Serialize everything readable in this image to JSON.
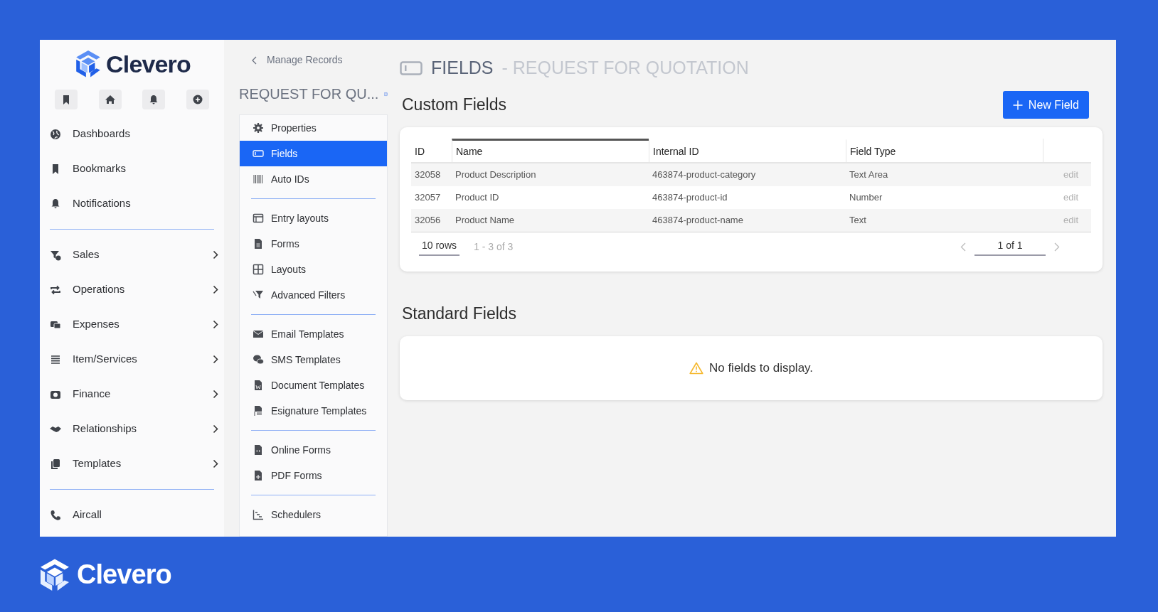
{
  "sidebar": {
    "logo": "Clevero",
    "items": [
      {
        "label": "Dashboards",
        "kind": "link"
      },
      {
        "label": "Bookmarks",
        "kind": "link"
      },
      {
        "label": "Notifications",
        "kind": "link"
      },
      {
        "label": "Sales",
        "kind": "group"
      },
      {
        "label": "Operations",
        "kind": "group"
      },
      {
        "label": "Expenses",
        "kind": "group"
      },
      {
        "label": "Item/Services",
        "kind": "group"
      },
      {
        "label": "Finance",
        "kind": "group"
      },
      {
        "label": "Relationships",
        "kind": "group"
      },
      {
        "label": "Templates",
        "kind": "group"
      },
      {
        "label": "Aircall",
        "kind": "link"
      }
    ]
  },
  "record_menu": {
    "back_link": "Manage Records",
    "title": "REQUEST FOR QU...",
    "groups": [
      [
        {
          "label": "Properties",
          "selected": false
        },
        {
          "label": "Fields",
          "selected": true
        },
        {
          "label": "Auto IDs",
          "selected": false
        }
      ],
      [
        {
          "label": "Entry layouts",
          "selected": false
        },
        {
          "label": "Forms",
          "selected": false
        },
        {
          "label": "Layouts",
          "selected": false
        },
        {
          "label": "Advanced Filters",
          "selected": false
        }
      ],
      [
        {
          "label": "Email Templates",
          "selected": false
        },
        {
          "label": "SMS Templates",
          "selected": false
        },
        {
          "label": "Document Templates",
          "selected": false
        },
        {
          "label": "Esignature Templates",
          "selected": false
        }
      ],
      [
        {
          "label": "Online Forms",
          "selected": false
        },
        {
          "label": "PDF Forms",
          "selected": false
        }
      ],
      [
        {
          "label": "Schedulers",
          "selected": false
        }
      ]
    ]
  },
  "page": {
    "title": "FIELDS",
    "subtitle": "- REQUEST FOR QUOTATION"
  },
  "custom_fields": {
    "heading": "Custom Fields",
    "new_button": "New Field",
    "columns": [
      {
        "label": "ID",
        "sorted": false
      },
      {
        "label": "Name",
        "sorted": true
      },
      {
        "label": "Internal ID",
        "sorted": false
      },
      {
        "label": "Field Type",
        "sorted": false
      }
    ],
    "rows": [
      {
        "cells": [
          "32058",
          "Product Description",
          "463874-product-category",
          "Text Area"
        ],
        "action": "edit"
      },
      {
        "cells": [
          "32057",
          "Product ID",
          "463874-product-id",
          "Number"
        ],
        "action": "edit"
      },
      {
        "cells": [
          "32056",
          "Product Name",
          "463874-product-name",
          "Text"
        ],
        "action": "edit"
      }
    ],
    "rows_per_page": "10 rows",
    "range": "1 - 3 of 3",
    "page": "1 of 1"
  },
  "standard_fields": {
    "heading": "Standard Fields",
    "empty_message": "No fields to display."
  },
  "footer_logo": "Clevero"
}
